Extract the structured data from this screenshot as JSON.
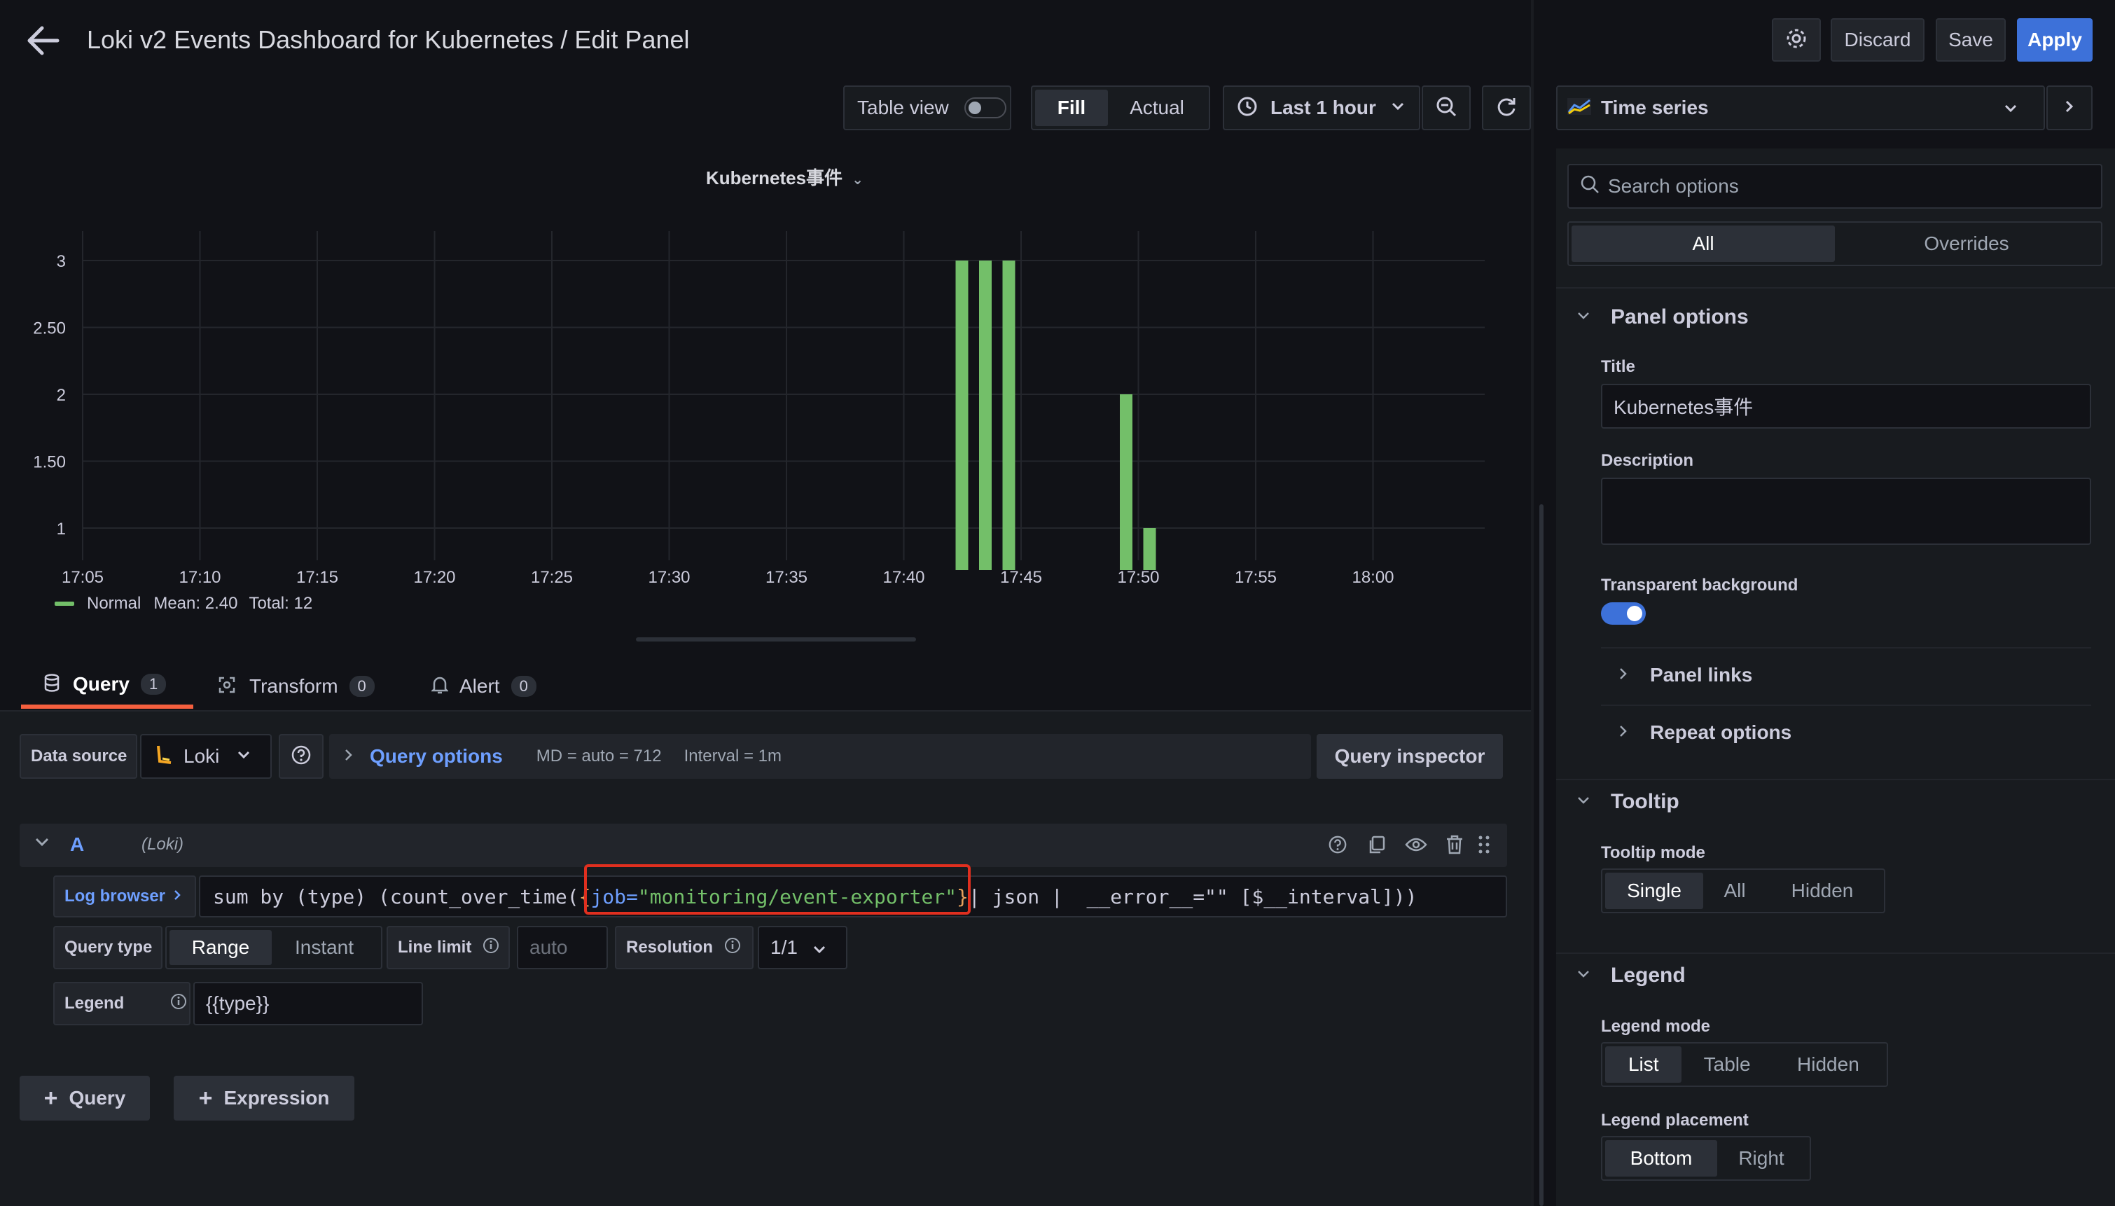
{
  "header": {
    "title": "Loki v2 Events Dashboard for Kubernetes / Edit Panel",
    "discard": "Discard",
    "save": "Save",
    "apply": "Apply"
  },
  "toolbar": {
    "table_view": "Table view",
    "fill": "Fill",
    "actual": "Actual",
    "time_range": "Last 1 hour",
    "visualization": "Time series"
  },
  "panel": {
    "title": "Kubernetes事件"
  },
  "chart_data": {
    "type": "bar",
    "title": "Kubernetes事件",
    "x_ticks": [
      "17:05",
      "17:10",
      "17:15",
      "17:20",
      "17:25",
      "17:30",
      "17:35",
      "17:40",
      "17:45",
      "17:50",
      "17:55",
      "18:00"
    ],
    "y_ticks": [
      "1",
      "1.50",
      "2",
      "2.50",
      "3"
    ],
    "ylim": [
      0.6,
      3.0
    ],
    "series": [
      {
        "name": "Normal",
        "color": "#73bf69",
        "points": [
          {
            "x": "17:42",
            "y": 3
          },
          {
            "x": "17:43",
            "y": 3
          },
          {
            "x": "17:44",
            "y": 3
          },
          {
            "x": "17:49",
            "y": 2
          },
          {
            "x": "17:50",
            "y": 1
          }
        ]
      }
    ],
    "legend": {
      "name": "Normal",
      "mean": "Mean: 2.40",
      "total": "Total: 12",
      "placement": "bottom"
    },
    "grid": true
  },
  "tabs": [
    {
      "label": "Query",
      "count": "1"
    },
    {
      "label": "Transform",
      "count": "0"
    },
    {
      "label": "Alert",
      "count": "0"
    }
  ],
  "datasource": {
    "label": "Data source",
    "name": "Loki",
    "query_options": "Query options",
    "md": "MD = auto = 712",
    "interval": "Interval = 1m",
    "inspector": "Query inspector"
  },
  "query": {
    "ref": "A",
    "source": "(Loki)",
    "log_browser": "Log browser",
    "expr": {
      "p1": "sum by (type) (count_over_time(",
      "p2": "{",
      "p3": "job=",
      "p4": "\"monitoring/event-exporter\"",
      "p5": "}",
      "p6": "| json |  __error__=\"\" [$__interval]))"
    },
    "query_type_label": "Query type",
    "range": "Range",
    "instant": "Instant",
    "line_limit_label": "Line limit",
    "line_limit_placeholder": "auto",
    "resolution_label": "Resolution",
    "resolution": "1/1",
    "legend_label": "Legend",
    "legend_value": "{{type}}"
  },
  "add": {
    "query": "Query",
    "expression": "Expression"
  },
  "options": {
    "search_placeholder": "Search options",
    "all": "All",
    "overrides": "Overrides",
    "panel_options": "Panel options",
    "title_label": "Title",
    "title_value": "Kubernetes事件",
    "description_label": "Description",
    "transparent_label": "Transparent background",
    "panel_links": "Panel links",
    "repeat_options": "Repeat options",
    "tooltip": "Tooltip",
    "tooltip_mode": "Tooltip mode",
    "tooltip_single": "Single",
    "tooltip_all": "All",
    "tooltip_hidden": "Hidden",
    "legend": "Legend",
    "legend_mode": "Legend mode",
    "legend_list": "List",
    "legend_table": "Table",
    "legend_hidden": "Hidden",
    "legend_placement": "Legend placement",
    "legend_bottom": "Bottom",
    "legend_right": "Right"
  },
  "colors": {
    "accent": "#3d71d9",
    "bar": "#73bf69",
    "highlight": "#e02f1f",
    "tab_active": "#f55f3e"
  }
}
